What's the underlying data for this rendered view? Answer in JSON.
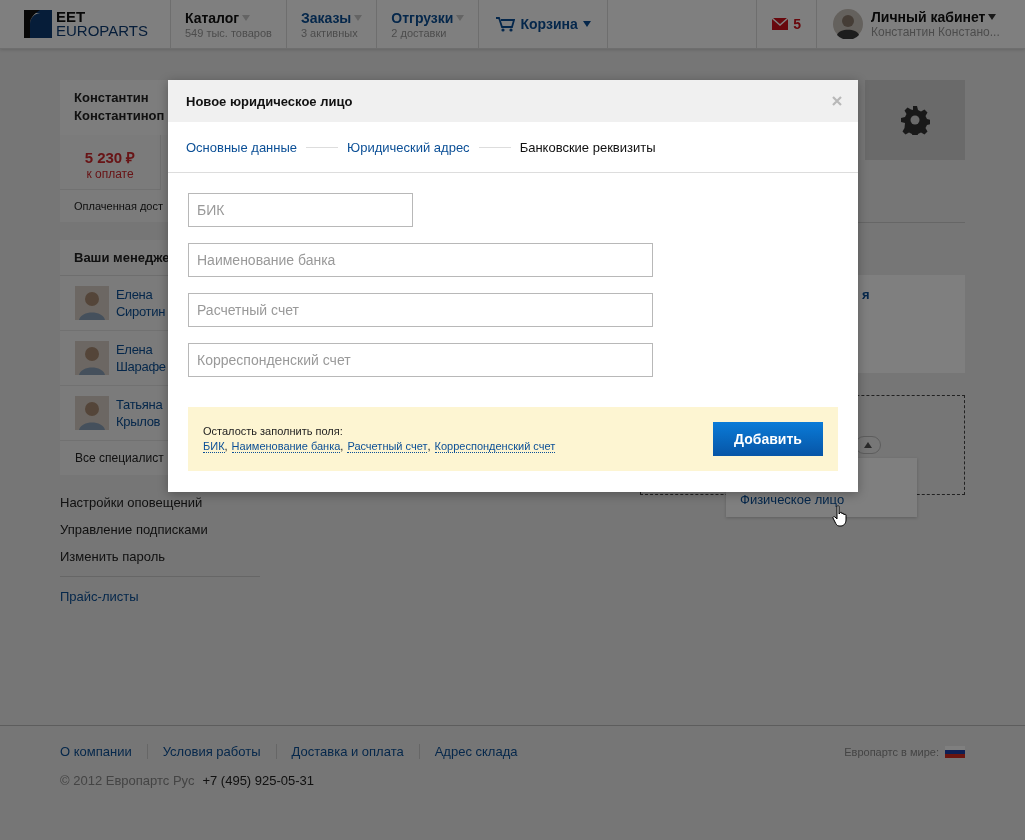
{
  "header": {
    "logo": {
      "line1": "EET",
      "line2": "EUROPARTS"
    },
    "nav": [
      {
        "label": "Каталог",
        "sub": "549 тыс. товаров",
        "selected": true
      },
      {
        "label": "Заказы",
        "sub": "3 активных",
        "selected": false
      },
      {
        "label": "Отгрузки",
        "sub": "2 доставки",
        "selected": false
      }
    ],
    "cart": "Корзина",
    "mail_count": "5",
    "account": {
      "title": "Личный кабинет",
      "name": "Константин Констано..."
    }
  },
  "profile": {
    "name_lines": [
      "Константин",
      "Константиноп"
    ],
    "amount": "5 230 ₽",
    "amount_label": "к оплате",
    "paid": "Оплаченная дост"
  },
  "managers": {
    "title": "Ваши менедже",
    "items": [
      {
        "first": "Елена",
        "last": "Сиротин"
      },
      {
        "first": "Елена",
        "last": "Шарафе"
      },
      {
        "first": "Татьяна",
        "last": "Крылов"
      }
    ],
    "all_link": "Все специалист"
  },
  "settings_links": [
    "Настройки оповещений",
    "Управление подписками",
    "Изменить пароль"
  ],
  "price_lists": "Прайс-листы",
  "right": {
    "card_text": "я",
    "popup_item": "Физическое лицо"
  },
  "modal": {
    "title": "Новое юридическое лицо",
    "steps": [
      {
        "label": "Основные данные",
        "selected": false
      },
      {
        "label": "Юридический адрес",
        "selected": false
      },
      {
        "label": "Банковские реквизиты",
        "selected": true
      }
    ],
    "fields": [
      {
        "placeholder": "БИК",
        "kind": "short"
      },
      {
        "placeholder": "Наименование банка",
        "kind": "wide"
      },
      {
        "placeholder": "Расчетный счет",
        "kind": "wide"
      },
      {
        "placeholder": "Корреспонденский счет",
        "kind": "wide"
      }
    ],
    "notice": {
      "text": "Осталость заполнить поля:",
      "separator": ",",
      "missing": [
        "БИК",
        "Наименование банка",
        "Расчетный счет",
        "Корреспонденский счет"
      ]
    },
    "submit": "Добавить"
  },
  "footer": {
    "links": [
      "О компании",
      "Условия работы",
      "Доставка и оплата",
      "Адрес склада"
    ],
    "copyright": "© 2012 Европартс Рус",
    "phone": "+7 (495) 925-05-31",
    "world_label": "Европартс в мире:"
  }
}
